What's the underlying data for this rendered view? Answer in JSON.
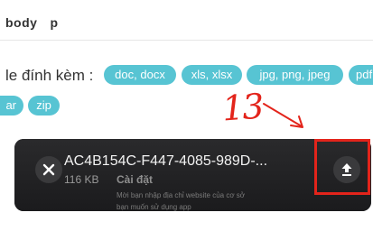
{
  "breadcrumb": {
    "items": [
      "body",
      "p"
    ]
  },
  "attachments": {
    "label": "le đính kèm :",
    "chips": [
      "doc, docx",
      "xls, xlsx",
      "jpg, png, jpeg",
      "pdf",
      "ar",
      "zip"
    ]
  },
  "annotation": {
    "number": "13",
    "color": "#e3241b"
  },
  "upload_card": {
    "file_name": "AC4B154C-F447-4085-989D-...",
    "file_size": "116 KB",
    "preview": {
      "title": "Cài đặt",
      "line1": "Mời bạn nhập địa chỉ website của cơ sở",
      "line2": "bạn muốn sử dụng app"
    },
    "close_icon": "close-icon",
    "upload_icon": "upload-icon"
  },
  "colors": {
    "chip": "#57c4d3",
    "card": "#1d1d1f",
    "highlight": "#e3241b"
  }
}
